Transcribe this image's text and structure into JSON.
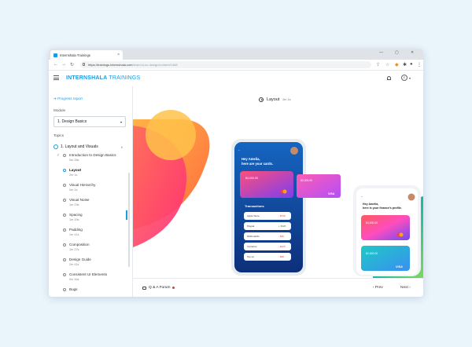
{
  "browser": {
    "tab_title": "Internshala Trainings",
    "tab_close": "×",
    "window_controls": [
      "—",
      "▢",
      "✕"
    ],
    "nav_back": "←",
    "nav_forward": "→",
    "nav_reload": "↻",
    "url_host": "https://trainings.internshala.com",
    "url_path": "/learn/ui-ux-design/content/1468"
  },
  "header": {
    "logo_main": "INTERNSHALA",
    "logo_sub": " TRAININGS",
    "avatar_letter": "E",
    "avatar_dropdown": "▾"
  },
  "sidebar": {
    "progress_report": "➔ Progress report",
    "module_label": "Module",
    "module_value": "1. Design Basics",
    "module_dropdown": "▾",
    "topics_label": "Topics",
    "chapter_title": "1. Layout and Visuals",
    "chapter_chevron": "˄",
    "check_mark": "✓",
    "items": [
      {
        "name": "Introduction to Design Basics",
        "duration": "0m 28s",
        "done": true
      },
      {
        "name": "Layout",
        "duration": "2m 1s",
        "active": true
      },
      {
        "name": "Visual Hierarchy",
        "duration": "0m 2s"
      },
      {
        "name": "Visual Noise",
        "duration": "1m 23s"
      },
      {
        "name": "Spacing",
        "duration": "1m 19s"
      },
      {
        "name": "Padding",
        "duration": "1m 41s"
      },
      {
        "name": "Composition",
        "duration": "1m 27s"
      },
      {
        "name": "Design Guide",
        "duration": "2m 41s"
      },
      {
        "name": "Consistent UI Elements",
        "duration": "0m 44s"
      },
      {
        "name": "Bugs",
        "duration": ""
      }
    ]
  },
  "video": {
    "title": "Layout",
    "duration": "2m 1s"
  },
  "mockup": {
    "phone1_greeting_1": "Hey Amelia,",
    "phone1_greeting_2": "here are your cards.",
    "card_amount_1": "$4,000.00",
    "card_amount_2": "$2,000.00",
    "card_brand": "VISA",
    "transactions_title": "Transactions",
    "transactions": [
      {
        "name": "Apple Store",
        "amount": "- $749"
      },
      {
        "name": "Paypal",
        "amount": "+ $326"
      },
      {
        "name": "McDonald's",
        "amount": "- $45"
      },
      {
        "name": "Carrefour",
        "amount": "- $125"
      },
      {
        "name": "Top up",
        "amount": "- $28"
      }
    ],
    "phone2_greeting_1": "Hey Amelia,",
    "phone2_greeting_2": "here is your finance's profile.",
    "phone2_card_1": "$4,000.00",
    "phone2_card_2": "$2,000.00",
    "phone2_brand": "VISA",
    "colors": {
      "orange": "#ff8a3d",
      "pink": "#ff3f7a",
      "navy": "#1b3f9e",
      "teal": "#17b6a8",
      "green": "#7ed957"
    }
  },
  "footer": {
    "qa_label": "Q & A Forum",
    "prev_label": "‹  Prev",
    "next_label": "Next  ›"
  }
}
